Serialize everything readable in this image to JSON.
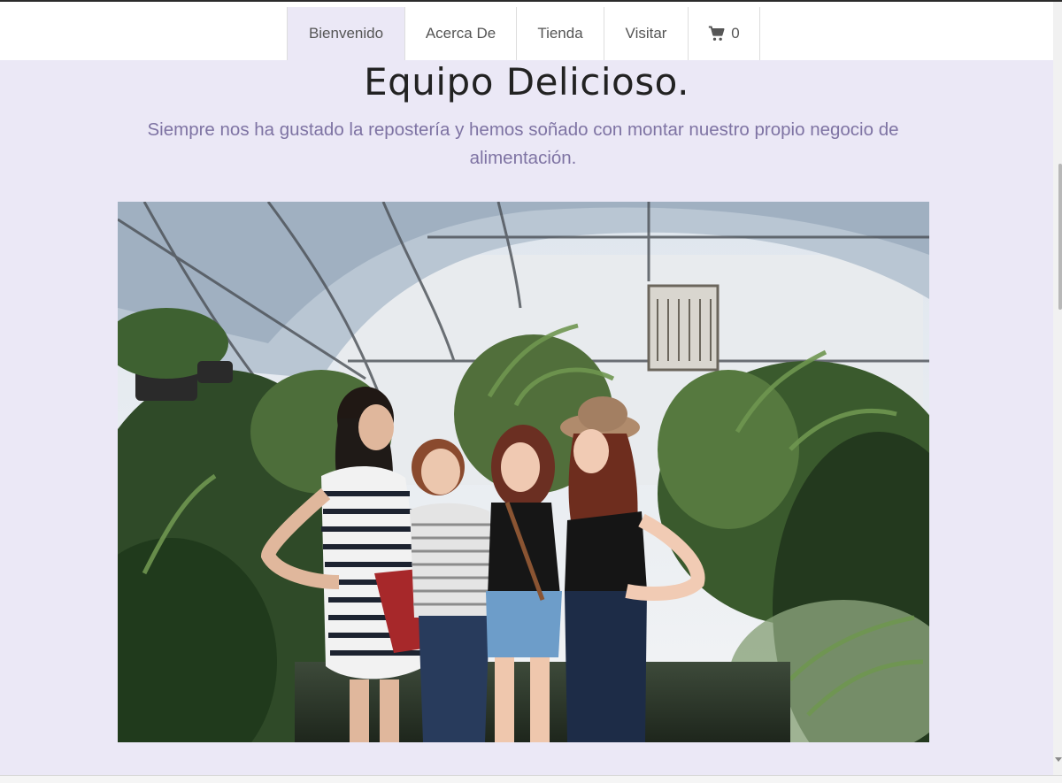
{
  "nav": {
    "items": [
      {
        "label": "Bienvenido",
        "active": true
      },
      {
        "label": "Acerca De",
        "active": false
      },
      {
        "label": "Tienda",
        "active": false
      },
      {
        "label": "Visitar",
        "active": false
      }
    ],
    "cart": {
      "icon": "shopping-cart-icon",
      "count": "0"
    }
  },
  "hero": {
    "title": "Equipo Delicioso.",
    "lead": "Siempre nos ha gustado la repostería y hemos soñado con montar nuestro propio negocio de alimentación."
  },
  "colors": {
    "page_background": "#ebe8f6",
    "active_nav": "#ebe8f6",
    "lead_text": "#7e73a3",
    "title_text": "#222222"
  },
  "photo": {
    "subject": "four young women laughing together inside a plant greenhouse"
  }
}
